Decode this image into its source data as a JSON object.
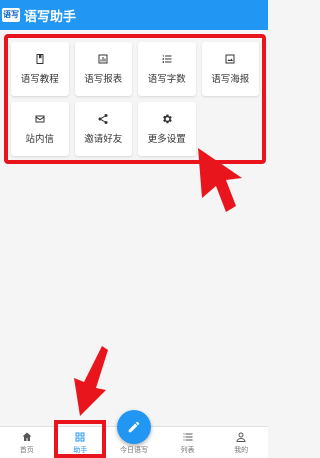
{
  "app": {
    "logo_text": "语写",
    "title": "语写助手"
  },
  "tiles": [
    {
      "label": "语写教程",
      "icon": "book-icon"
    },
    {
      "label": "语写报表",
      "icon": "bar-chart-icon"
    },
    {
      "label": "语写字数",
      "icon": "list-numbered-icon"
    },
    {
      "label": "语写海报",
      "icon": "image-icon"
    },
    {
      "label": "站内信",
      "icon": "mail-icon"
    },
    {
      "label": "邀请好友",
      "icon": "share-icon"
    },
    {
      "label": "更多设置",
      "icon": "gear-icon"
    }
  ],
  "bottom_nav": {
    "items": [
      {
        "label": "首页",
        "icon": "home-icon"
      },
      {
        "label": "助手",
        "icon": "grid-icon",
        "active": true
      },
      {
        "label": "今日语写",
        "icon": "pencil-icon"
      },
      {
        "label": "列表",
        "icon": "list-icon"
      },
      {
        "label": "我的",
        "icon": "person-icon"
      }
    ]
  },
  "colors": {
    "primary": "#2196f3",
    "annotation_red": "#e8161c"
  }
}
